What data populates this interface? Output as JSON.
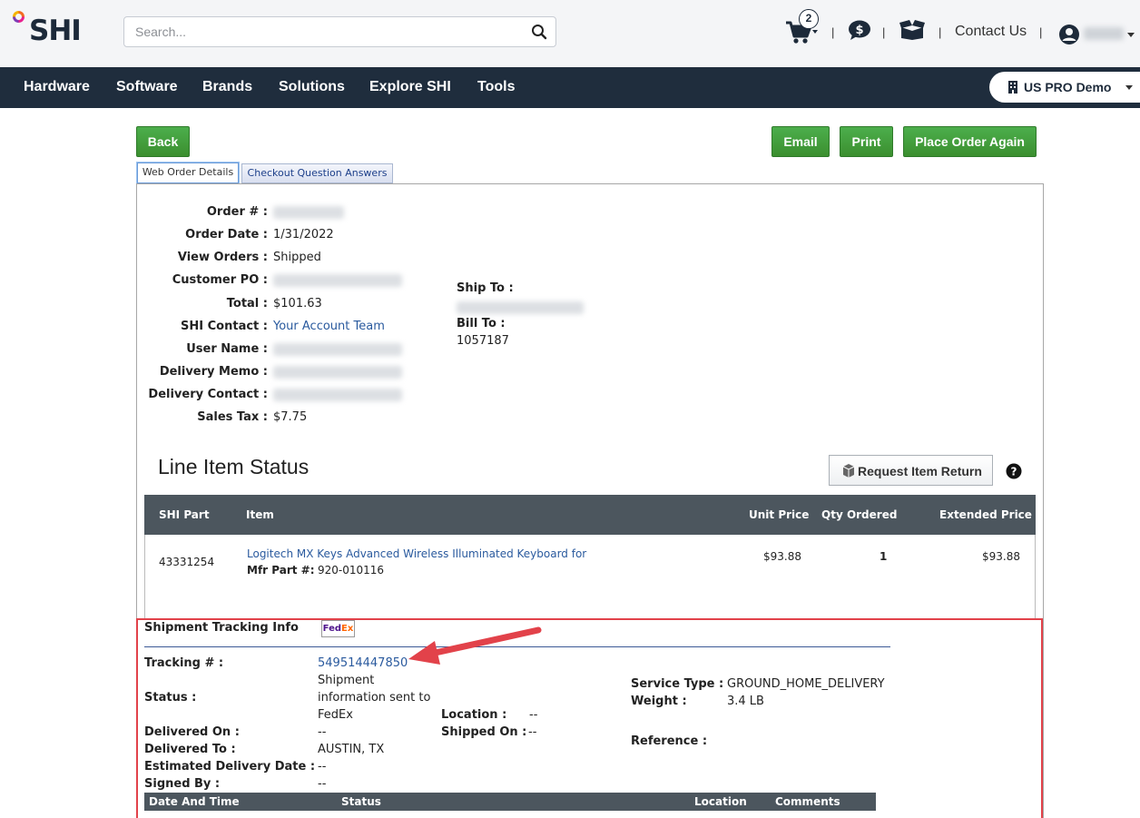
{
  "header": {
    "logo_text": "SHI",
    "search_placeholder": "Search...",
    "cart_count": "2",
    "separator": "|",
    "contact_label": "Contact Us"
  },
  "nav": {
    "items": [
      "Hardware",
      "Software",
      "Brands",
      "Solutions",
      "Explore SHI",
      "Tools"
    ],
    "account_label": "US PRO Demo"
  },
  "buttons": {
    "back": "Back",
    "email": "Email",
    "print": "Print",
    "place_order_again": "Place Order Again"
  },
  "tabs": [
    "Web Order Details",
    "Checkout Question Answers"
  ],
  "order": {
    "order_no_label": "Order # :",
    "order_date_label": "Order Date :",
    "order_date": "1/31/2022",
    "view_orders_label": "View Orders :",
    "view_orders": "Shipped",
    "customer_po_label": "Customer PO :",
    "total_label": "Total :",
    "total": "$101.63",
    "shi_contact_label": "SHI Contact :",
    "shi_contact": "Your Account Team",
    "user_name_label": "User Name :",
    "delivery_memo_label": "Delivery Memo :",
    "delivery_contact_label": "Delivery Contact :",
    "sales_tax_label": "Sales Tax :",
    "sales_tax": "$7.75",
    "ship_to_label": "Ship To :",
    "bill_to_label": "Bill To :",
    "bill_to": "1057187"
  },
  "line_items": {
    "title": "Line Item Status",
    "request_return": "Request Item Return",
    "columns": [
      "SHI Part",
      "Item",
      "Unit Price",
      "Qty Ordered",
      "Extended Price"
    ],
    "rows": [
      {
        "shi_part": "43331254",
        "item": "Logitech MX Keys Advanced Wireless Illuminated Keyboard for",
        "mfr_label": "Mfr Part #:",
        "mfr_part": "920-010116",
        "unit_price": "$93.88",
        "qty": "1",
        "extended_price": "$93.88"
      }
    ]
  },
  "shipment": {
    "title": "Shipment Tracking Info",
    "tracking_label": "Tracking # :",
    "tracking_number": "549514447850",
    "status_label": "Status :",
    "status_line1": "Shipment",
    "status_line2": "information sent to",
    "status_line3": "FedEx",
    "delivered_on_label": "Delivered On :",
    "delivered_on": "--",
    "delivered_to_label": "Delivered To :",
    "delivered_to": "AUSTIN, TX",
    "est_delivery_label": "Estimated Delivery Date :",
    "est_delivery": "--",
    "signed_by_label": "Signed By :",
    "signed_by": "--",
    "location_label": "Location :",
    "location": "--",
    "shipped_on_label": "Shipped On :",
    "shipped_on": "--",
    "service_type_label": "Service Type :",
    "service_type": "GROUND_HOME_DELIVERY",
    "weight_label": "Weight :",
    "weight": "3.4 LB",
    "reference_label": "Reference :",
    "columns": [
      "Date And Time",
      "Status",
      "Location",
      "Comments"
    ]
  },
  "colors": {
    "navbar": "#1f2d3d",
    "button_green": "#3b8f2f",
    "highlight_red": "#e2424a",
    "link_blue": "#2a5a9e"
  }
}
